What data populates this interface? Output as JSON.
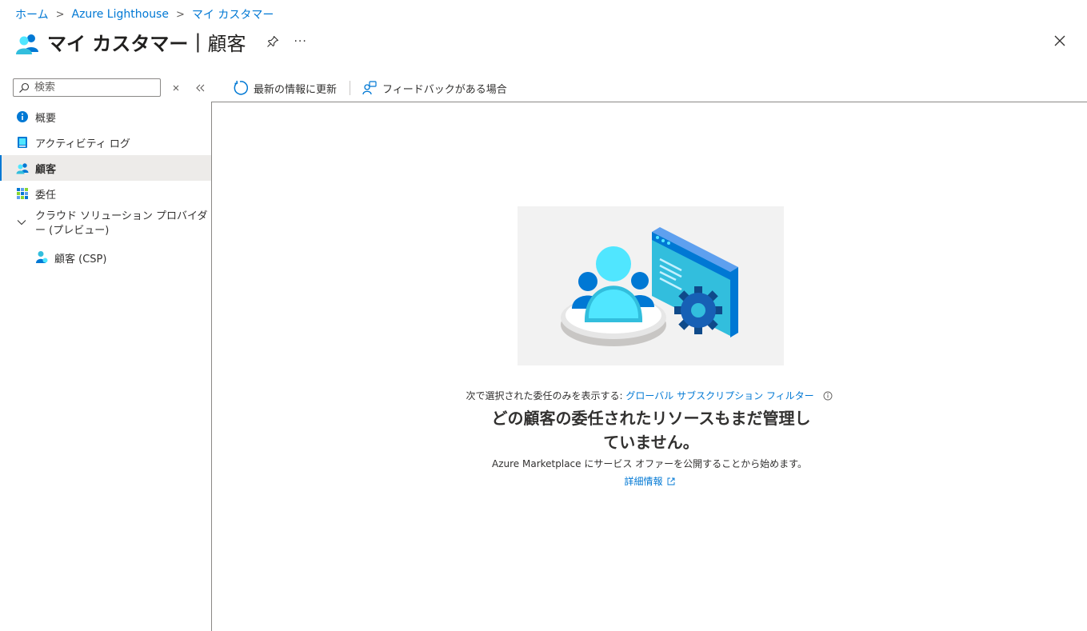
{
  "breadcrumb": {
    "home": "ホーム",
    "lighthouse": "Azure Lighthouse",
    "current": "マイ カスタマー"
  },
  "header": {
    "title": "マイ カスタマー",
    "separator": "|",
    "subtitle": "顧客",
    "more": "···"
  },
  "search": {
    "placeholder": "検索"
  },
  "toolbar": {
    "refresh": "最新の情報に更新",
    "feedback": "フィードバックがある場合"
  },
  "sidebar": {
    "items": [
      {
        "label": "概要",
        "icon": "info-icon"
      },
      {
        "label": "アクティビティ ログ",
        "icon": "activity-log-icon"
      },
      {
        "label": "顧客",
        "icon": "customers-icon",
        "active": true
      },
      {
        "label": "委任",
        "icon": "delegations-icon"
      }
    ],
    "group": {
      "label": "クラウド ソリューション プロバイダー (プレビュー)",
      "expanded": true
    },
    "sub_items": [
      {
        "label": "顧客 (CSP)",
        "icon": "customer-csp-icon"
      }
    ]
  },
  "main": {
    "filter_prefix": "次で選択された委任のみを表示する:",
    "filter_link": "グローバル サブスクリプション フィルター",
    "empty_title": "どの顧客の委任されたリソースもまだ管理していません。",
    "empty_desc": "Azure Marketplace にサービス オファーを公開することから始めます。",
    "learn_more": "詳細情報"
  },
  "colors": {
    "accent": "#0078d4",
    "active_bg": "#edebe9"
  }
}
